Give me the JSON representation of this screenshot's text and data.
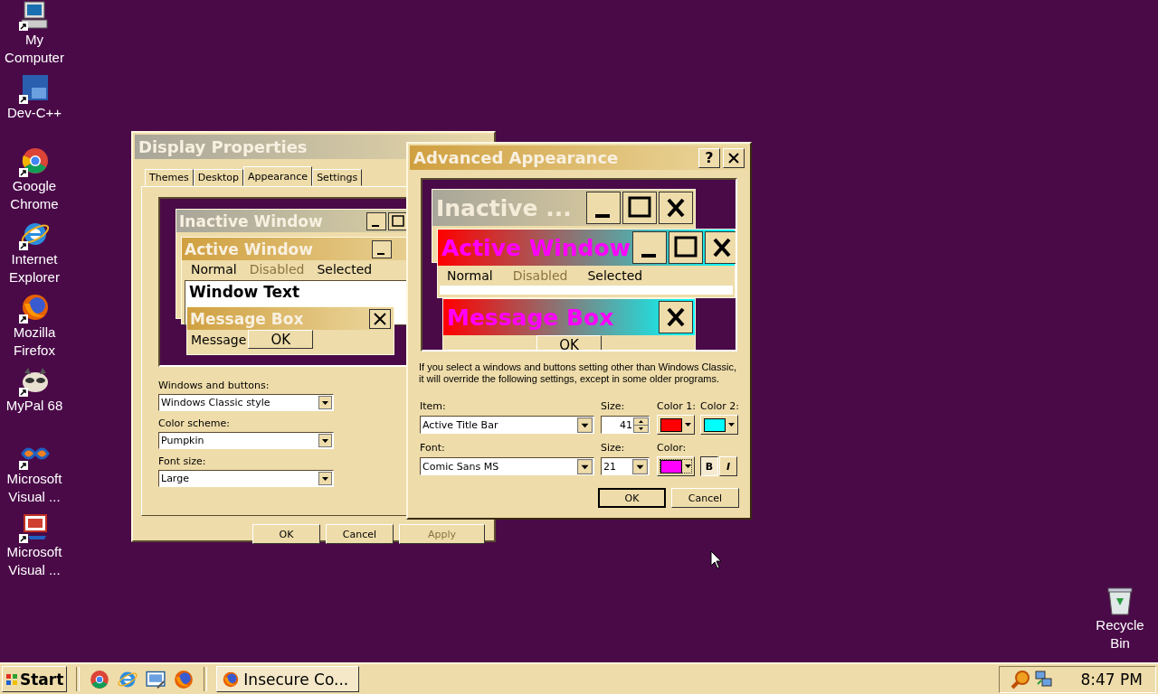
{
  "desktop_icons": [
    {
      "label": "My Computer",
      "kind": "computer"
    },
    {
      "label": "Dev-C++",
      "kind": "devcpp"
    },
    {
      "label": "Google Chrome",
      "kind": "chrome"
    },
    {
      "label": "Internet Explorer",
      "kind": "ie"
    },
    {
      "label": "Mozilla Firefox",
      "kind": "firefox"
    },
    {
      "label": "MyPal 68",
      "kind": "mypal"
    },
    {
      "label": "Microsoft Visual ...",
      "kind": "vs"
    },
    {
      "label": "Microsoft Visual ...",
      "kind": "vj"
    }
  ],
  "recycle_bin": {
    "label": "Recycle Bin"
  },
  "display_properties": {
    "title": "Display Properties",
    "tabs": [
      {
        "label": "Themes",
        "selected": false
      },
      {
        "label": "Desktop",
        "selected": false
      },
      {
        "label": "Appearance",
        "selected": true
      },
      {
        "label": "Settings",
        "selected": false
      }
    ],
    "preview": {
      "inactive_title": "Inactive Window",
      "active_title": "Active Window",
      "menu": [
        {
          "label": "Normal",
          "disabled": false
        },
        {
          "label": "Disabled",
          "disabled": true
        },
        {
          "label": "Selected",
          "disabled": false
        }
      ],
      "window_text": "Window Text",
      "message_title": "Message Box",
      "message_text": "Message",
      "ok": "OK"
    },
    "fields": [
      {
        "label": "Windows and buttons:",
        "value": "Windows Classic style"
      },
      {
        "label": "Color scheme:",
        "value": "Pumpkin"
      },
      {
        "label": "Font size:",
        "value": "Large"
      }
    ],
    "buttons": [
      {
        "label": "OK",
        "disabled": false
      },
      {
        "label": "Cancel",
        "disabled": false
      },
      {
        "label": "Apply",
        "disabled": true
      }
    ]
  },
  "advanced": {
    "title": "Advanced Appearance",
    "help": "?",
    "preview": {
      "inactive_title": "Inactive ...",
      "active_title": "Active Window",
      "menu": [
        {
          "label": "Normal",
          "disabled": false
        },
        {
          "label": "Disabled",
          "disabled": true
        },
        {
          "label": "Selected",
          "disabled": false
        }
      ],
      "message_title": "Message Box",
      "ok": "OK"
    },
    "note": "If you select a windows and buttons setting other than Windows Classic, it will override the following settings, except in some older programs.",
    "item": {
      "label": "Item:",
      "value": "Active Title Bar",
      "size_label": "Size:",
      "size": "41",
      "colors": [
        {
          "label": "Color 1:",
          "color": "#ff0000"
        },
        {
          "label": "Color 2:",
          "color": "#00ffff"
        }
      ]
    },
    "font": {
      "label": "Font:",
      "value": "Comic Sans MS",
      "size_label": "Size:",
      "size": "21",
      "colors": [
        {
          "label": "Color:",
          "color": "#ff00ff"
        }
      ],
      "bold": {
        "label": "B",
        "selected": true
      },
      "italic": {
        "label": "I",
        "selected": false
      }
    },
    "buttons": [
      {
        "label": "OK",
        "default": true
      },
      {
        "label": "Cancel",
        "default": false
      }
    ]
  },
  "taskbar": {
    "start": "Start",
    "quick_launch": [
      {
        "kind": "chrome"
      },
      {
        "kind": "ie"
      },
      {
        "kind": "desktop"
      },
      {
        "kind": "firefox"
      }
    ],
    "tasks": [
      {
        "label": "Insecure Co...",
        "kind": "firefox"
      }
    ],
    "clock": "8:47 PM"
  }
}
